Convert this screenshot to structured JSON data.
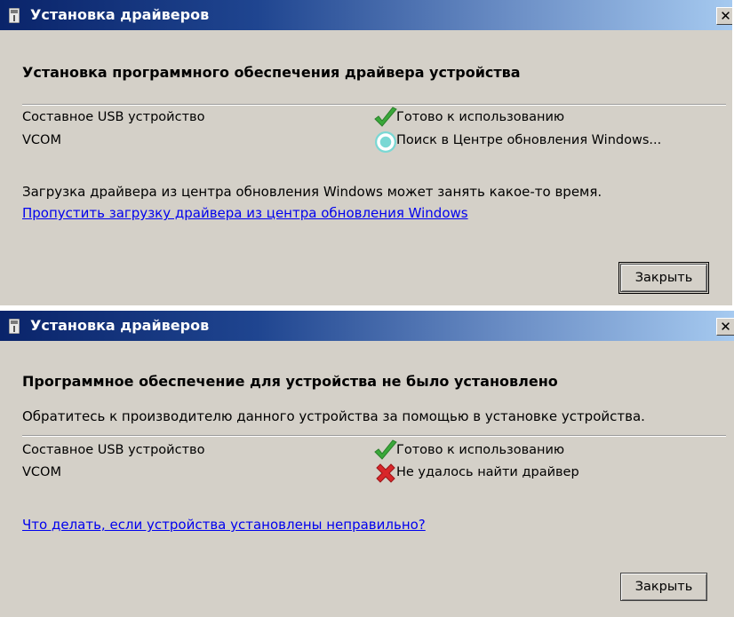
{
  "windows": [
    {
      "title": "Установка драйверов",
      "close_glyph": "✕",
      "heading": "Установка программного обеспечения драйвера устройства",
      "devices": [
        {
          "name": "Составное USB устройство",
          "status": "Готово к использованию",
          "status_icon": "check-icon"
        },
        {
          "name": "VCOM",
          "status": "Поиск в Центре обновления Windows...",
          "status_icon": "searching-spinner-icon"
        }
      ],
      "info_text": "Загрузка драйвера из центра обновления Windows может занять какое-то время.",
      "link_text": "Пропустить загрузку драйвера из центра обновления Windows",
      "button_label": "Закрыть"
    },
    {
      "title": "Установка драйверов",
      "close_glyph": "✕",
      "heading": "Программное обеспечение для устройства не было установлено",
      "info_text": "Обратитесь к производителю данного устройства за помощью в установке устройства.",
      "devices": [
        {
          "name": "Составное USB устройство",
          "status": "Готово к использованию",
          "status_icon": "check-icon"
        },
        {
          "name": "VCOM",
          "status": "Не удалось найти драйвер",
          "status_icon": "error-x-icon"
        }
      ],
      "link_text": "Что делать, если устройства установлены неправильно?",
      "button_label": "Закрыть"
    }
  ],
  "colors": {
    "window_bg": "#d4d0c8",
    "titlebar_start": "#0a246a",
    "titlebar_end": "#a6caf0",
    "link": "#0000ee",
    "check": "#3aa83a",
    "error": "#d8262a"
  }
}
